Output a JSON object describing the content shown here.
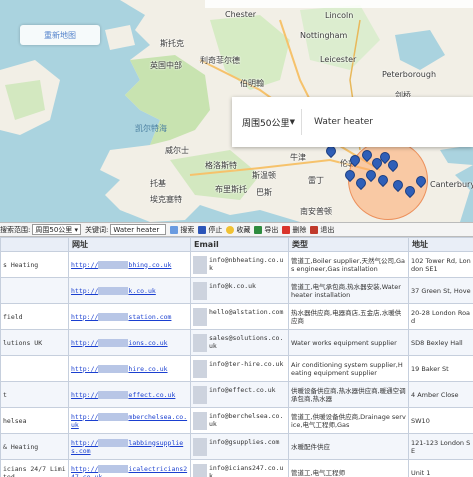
{
  "map": {
    "top_pill": "重新地图",
    "labels": {
      "chester": "Chester",
      "lincoln": "Lincoln",
      "stoke": "斯托克",
      "nottingham": "Nottingham",
      "lichfield": "利奇菲尔德",
      "leicester": "Leicester",
      "peterborough": "Peterborough",
      "birmingham": "伯明翰",
      "cardiff_area": "英国中部",
      "gloucester": "格洛斯特",
      "cambridge": "剑桥",
      "oxford": "牛津",
      "celtic_sea": "凯尔特海",
      "bristol": "布里斯托",
      "swindon": "斯温顿",
      "reading": "雷丁",
      "london": "伦敦",
      "wales": "威尔士",
      "torbay": "托基",
      "exeter": "埃克塞特",
      "bath": "巴斯",
      "brighton": "南安普顿",
      "canterbury": "Canterbury"
    },
    "search": {
      "radius_value": "周围50公里",
      "keyword": "Water heater"
    }
  },
  "toolbar": {
    "range_label": "搜索范围:",
    "range_value": "周围50公里",
    "keyword_label": "关键词:",
    "keyword_value": "Water heater",
    "search_btn": "搜索",
    "stop_btn": "停止",
    "fav_btn": "收藏",
    "export_btn": "导出",
    "clear_btn": "删除",
    "exit_btn": "退出"
  },
  "table": {
    "headers": [
      "",
      "网址",
      "Email",
      "",
      "类型",
      "地址"
    ],
    "rows": [
      [
        "s Heating",
        "http://",
        "bhing.co.uk",
        "info@",
        "nbheating.co.uk",
        "管道工,Boiler supplier,天然气公司,Gas engineer,Gas installation",
        "102 Tower Rd, London SE1"
      ],
      [
        "",
        "http://",
        "k.co.uk",
        "info@",
        "k.co.uk",
        "管道工,电气承包商,热水器安装,Water heater installation",
        "37 Green St, Hove"
      ],
      [
        "field",
        "http://",
        "station.com",
        "hello@",
        "alstation.com",
        "热水器供应商,电器商店,五金店,水暖供应商",
        "20-28 London Road"
      ],
      [
        "lutions UK",
        "http://",
        "ions.co.uk",
        "sales@",
        "solutions.co.uk",
        "Water works equipment supplier",
        "SD8 Bexley Hall"
      ],
      [
        "",
        "http://",
        "hire.co.uk",
        "info@",
        "ter-hire.co.uk",
        "Air conditioning system supplier,Heating equipment supplier",
        "19 Baker St"
      ],
      [
        "t",
        "http://",
        "effect.co.uk",
        "info@",
        "effect.co.uk",
        "供暖设备供应商,热水器供应商,暖通空调承包商,热水器",
        "4 Amber Close"
      ],
      [
        "helsea",
        "http://",
        "mberchelsea.co.uk",
        "info@",
        "berchelsea.co.uk",
        "管道工,供暖设备供应商,Drainage service,电气工程师,Gas",
        "SW10"
      ],
      [
        "& Heating",
        "http://",
        "labbingsupplies.com",
        "info@",
        "gsupplies.com",
        "水暖配件供应",
        "121-123 London SE"
      ],
      [
        "icians 24/7 Limited",
        "http://",
        "icalectricians247.co.uk",
        "info@",
        "icians247.co.uk",
        "管道工,电气工程师",
        "Unit 1"
      ]
    ]
  }
}
